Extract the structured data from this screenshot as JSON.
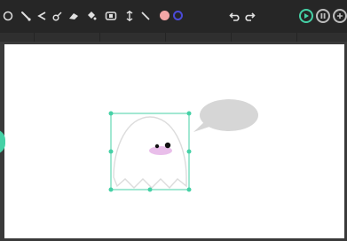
{
  "toolbar": {
    "tools": [
      {
        "name": "ellipse-tool-icon"
      },
      {
        "name": "brush-tool-icon"
      },
      {
        "name": "polyline-tool-icon"
      },
      {
        "name": "curve-tool-icon"
      },
      {
        "name": "eraser-tool-icon"
      },
      {
        "name": "fill-tool-icon"
      },
      {
        "name": "group-tool-icon"
      },
      {
        "name": "width-tool-icon"
      },
      {
        "name": "line-tool-icon"
      }
    ],
    "fill_color": "#f2a6a6",
    "stroke_color": "#4a4ad8",
    "undo_icon": "undo-icon",
    "redo_icon": "redo-icon",
    "play_icon": "play-icon",
    "pause_icon": "pause-icon",
    "add_icon": "add-icon"
  },
  "canvas": {
    "ghost_color": "#ffffff",
    "ghost_outline": "#cfcfcf",
    "blush_color": "#e7b7e8",
    "bubble_color": "#d6d6d6",
    "selection_color": "#45d1a6"
  }
}
